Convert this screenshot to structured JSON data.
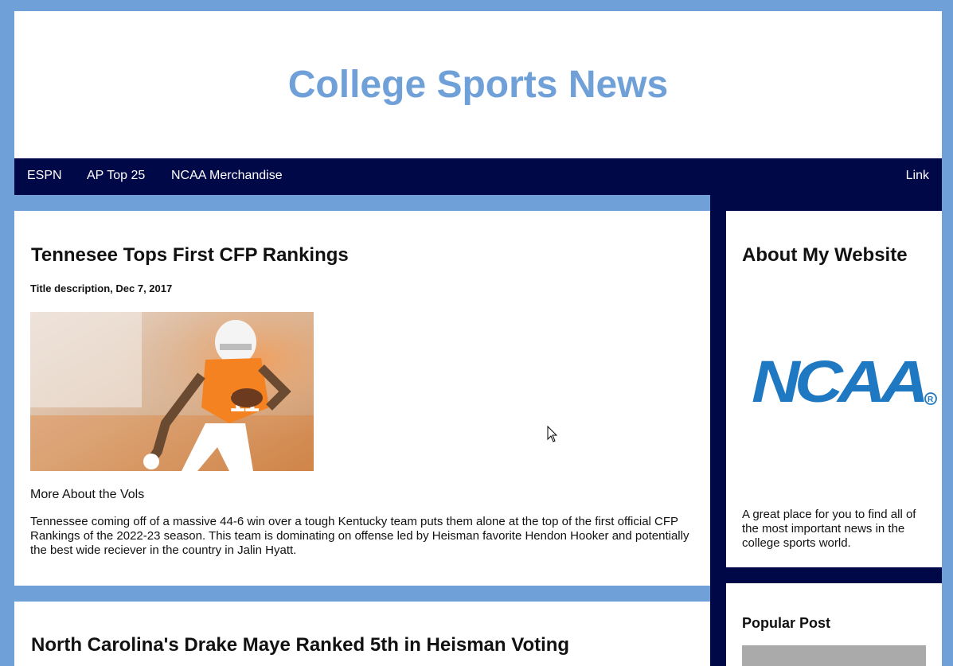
{
  "header": {
    "title": "College Sports News"
  },
  "topnav": {
    "items": [
      {
        "label": "ESPN"
      },
      {
        "label": "AP Top 25"
      },
      {
        "label": "NCAA Merchandise"
      }
    ],
    "right_link": "Link"
  },
  "posts": [
    {
      "title": "Tennesee Tops First CFP Rankings",
      "subtitle": "Title description, Dec 7, 2017",
      "image_alt": "Tennessee player running with football",
      "section_heading": "More About the Vols",
      "body": "Tennessee coming off of a massive 44-6 win over a tough Kentucky team puts them alone at the top of the first official CFP Rankings of the 2022-23 season. This team is dominating on offense led by Heisman favorite Hendon Hooker and potentially the best wide reciever in the country in Jalin Hyatt."
    },
    {
      "title": "North Carolina's Drake Maye Ranked 5th in Heisman Voting"
    }
  ],
  "sidebar": {
    "about": {
      "title": "About My Website",
      "logo_text": "NCAA",
      "description": "A great place for you to find all of the most important news in the college sports world."
    },
    "popular": {
      "title": "Popular Post"
    }
  },
  "colors": {
    "page_background": "#70a0d8",
    "nav_background": "#000848",
    "title_color": "#70a0d8",
    "ncaa_blue": "#1f78c2"
  }
}
